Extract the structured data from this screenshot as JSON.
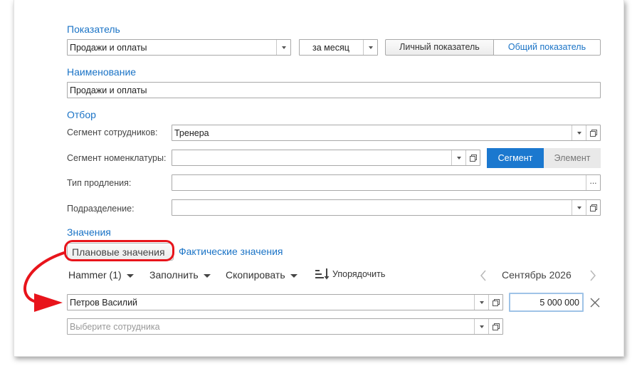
{
  "sections": {
    "indicator": "Показатель",
    "name": "Наименование",
    "filter": "Отбор",
    "values": "Значения"
  },
  "indicator": {
    "value": "Продажи и оплаты",
    "period": "за месяц",
    "personal_label": "Личный показатель",
    "common_label": "Общий показатель"
  },
  "name_field": {
    "value": "Продажи и оплаты"
  },
  "filter": {
    "employee_segment_label": "Сегмент сотрудников:",
    "employee_segment_value": "Тренера",
    "nomenclature_segment_label": "Сегмент номенклатуры:",
    "nomenclature_segment_value": "",
    "segment_toggle": "Сегмент",
    "element_toggle": "Элемент",
    "extension_type_label": "Тип продления:",
    "extension_type_value": "",
    "department_label": "Подразделение:",
    "department_value": ""
  },
  "values_tabs": {
    "planned": "Плановые значения",
    "actual": "Фактические значения"
  },
  "toolbar": {
    "hammer": "Hammer (1)",
    "fill": "Заполнить",
    "copy": "Скопировать",
    "sort": "Упорядочить",
    "period": "Сентябрь 2026"
  },
  "rows": [
    {
      "employee": "Петров Василий",
      "amount": "5 000 000"
    }
  ],
  "new_row": {
    "placeholder": "Выберите сотрудника"
  },
  "colors": {
    "accent": "#1a73c6",
    "active_toggle": "#1b78cf",
    "annotation": "#e8141b"
  }
}
